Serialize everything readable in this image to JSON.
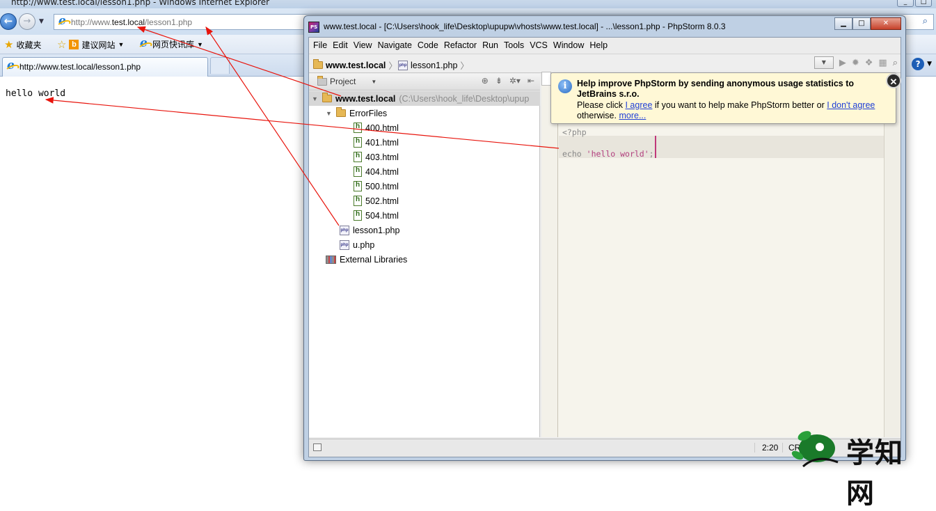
{
  "ie": {
    "window_title": "http://www.test.local/lesson1.php - Windows Internet Explorer",
    "address": {
      "prefix": "http://www.",
      "host": "test.local",
      "path": "/lesson1.php"
    },
    "favorites": [
      {
        "label": "收藏夹"
      },
      {
        "label": "建议网站"
      },
      {
        "label": "网页快讯库"
      }
    ],
    "tab_label": "http://www.test.local/lesson1.php",
    "page_output": "hello world"
  },
  "phpstorm": {
    "window_title": "www.test.local - [C:\\Users\\hook_life\\Desktop\\upupw\\vhosts\\www.test.local] - ...\\lesson1.php - PhpStorm 8.0.3",
    "menu": [
      "File",
      "Edit",
      "View",
      "Navigate",
      "Code",
      "Refactor",
      "Run",
      "Tools",
      "VCS",
      "Window",
      "Help"
    ],
    "breadcrumb": {
      "project": "www.test.local",
      "file": "lesson1.php"
    },
    "project_panel_label": "Project",
    "tree": {
      "root_name": "www.test.local",
      "root_path": "(C:\\Users\\hook_life\\Desktop\\upup",
      "folder": "ErrorFiles",
      "html_files": [
        "400.html",
        "401.html",
        "403.html",
        "404.html",
        "500.html",
        "502.html",
        "504.html"
      ],
      "php_files": [
        "lesson1.php",
        "u.php"
      ],
      "libraries": "External Libraries"
    },
    "code": {
      "line1": "<?php",
      "echo_kw": "echo",
      "echo_str": "'hello world'",
      "semicolon": ";"
    },
    "status": {
      "position": "2:20",
      "line_sep": "CRL"
    },
    "notification": {
      "title": "Help improve PhpStorm by sending anonymous usage statistics to JetBrains s.r.o.",
      "text1": "Please click",
      "agree": "I agree",
      "text2": "if you want to help make PhpStorm better or",
      "disagree": "I don't agree",
      "text3": "otherwise.",
      "more": "more..."
    }
  },
  "watermark": {
    "text": "学知网"
  },
  "colors": {
    "arrow": "#e8140c",
    "accent_link": "#1f3fd6",
    "string": "#b23e7e"
  }
}
